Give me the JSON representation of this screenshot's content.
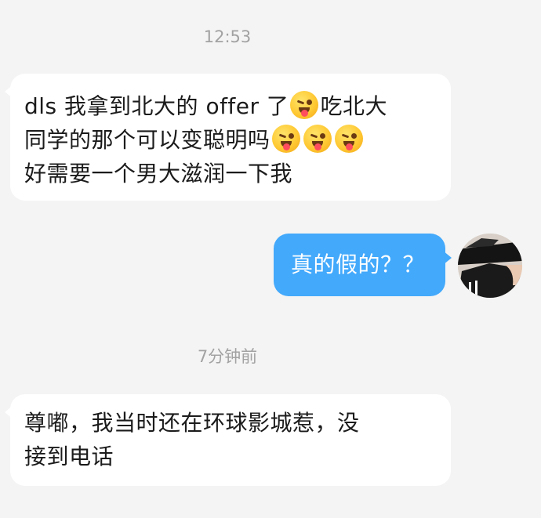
{
  "chat": {
    "timestamps": [
      "12:53",
      "7分钟前"
    ],
    "messages": [
      {
        "direction": "incoming",
        "lines": [
          [
            "dls 我拿到北大的 offer 了",
            "吃北大"
          ],
          [
            "同学的那个可以变聪明吗"
          ],
          [
            "好需要一个男大滋润一下我"
          ]
        ],
        "emoji": "zany-face"
      },
      {
        "direction": "outgoing",
        "text": "真的假的？？"
      },
      {
        "direction": "incoming",
        "lines": [
          "尊嘟，我当时还在环球影城惹，没",
          "接到电话"
        ]
      }
    ]
  },
  "colors": {
    "background": "#f4f4f4",
    "incoming_bubble": "#ffffff",
    "outgoing_bubble": "#43a9fb",
    "timestamp": "#a2a2a2"
  },
  "icons": [
    "zany-face-emoji",
    "user-avatar"
  ]
}
